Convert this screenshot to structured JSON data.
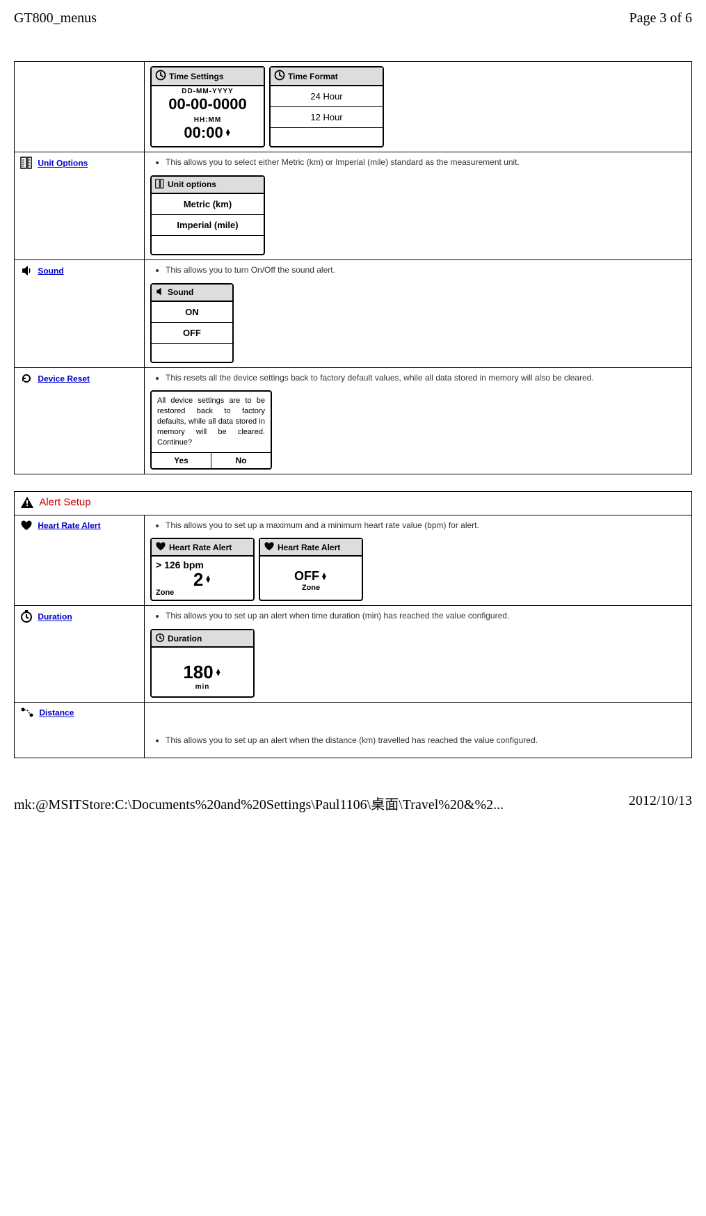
{
  "header": {
    "left": "GT800_menus",
    "right": "Page 3 of 6"
  },
  "footer": {
    "left": "mk:@MSITStore:C:\\Documents%20and%20Settings\\Paul1106\\桌面\\Travel%20&%2...",
    "right": "2012/10/13"
  },
  "rowTimeSettings": {
    "screen1": {
      "title": "Time Settings",
      "line1": "DD-MM-YYYY",
      "big1": "00-00-0000",
      "line2": "HH:MM",
      "big2": "00:00"
    },
    "screen2": {
      "title": "Time Format",
      "opt1": "24 Hour",
      "opt2": "12 Hour"
    }
  },
  "rowUnit": {
    "label": "Unit Options",
    "desc": "This allows you to select either Metric (km) or Imperial (mile) standard as the measurement unit.",
    "screen": {
      "title": "Unit options",
      "opt1": "Metric (km)",
      "opt2": "Imperial (mile)"
    }
  },
  "rowSound": {
    "label": "Sound",
    "desc": "This allows you to turn On/Off the sound alert.",
    "screen": {
      "title": "Sound",
      "opt1": "ON",
      "opt2": "OFF"
    }
  },
  "rowReset": {
    "label": "Device Reset",
    "desc": "This resets all the device settings back to factory default values, while all data stored in memory will also be cleared.",
    "dialogText": "All device settings are to be restored back to factory defaults, while all data stored in memory will be cleared. Continue?",
    "yes": "Yes",
    "no": "No"
  },
  "alertSection": {
    "title": "Alert Setup"
  },
  "rowHR": {
    "label": "Heart Rate Alert",
    "desc": "This allows you to set up a maximum and a minimum heart rate value (bpm) for alert.",
    "screen1": {
      "title": "Heart Rate Alert",
      "top": "> 126 bpm",
      "big": "2",
      "zone": "Zone"
    },
    "screen2": {
      "title": "Heart Rate Alert",
      "big": "OFF",
      "zone": "Zone"
    }
  },
  "rowDuration": {
    "label": "Duration",
    "desc": "This allows you to set up an alert when time duration (min) has reached the value configured.",
    "screen": {
      "title": "Duration",
      "big": "180",
      "unit": "min"
    }
  },
  "rowDistance": {
    "label": "Distance",
    "desc": "This allows you to set up an alert when the distance (km) travelled has reached the value configured."
  }
}
